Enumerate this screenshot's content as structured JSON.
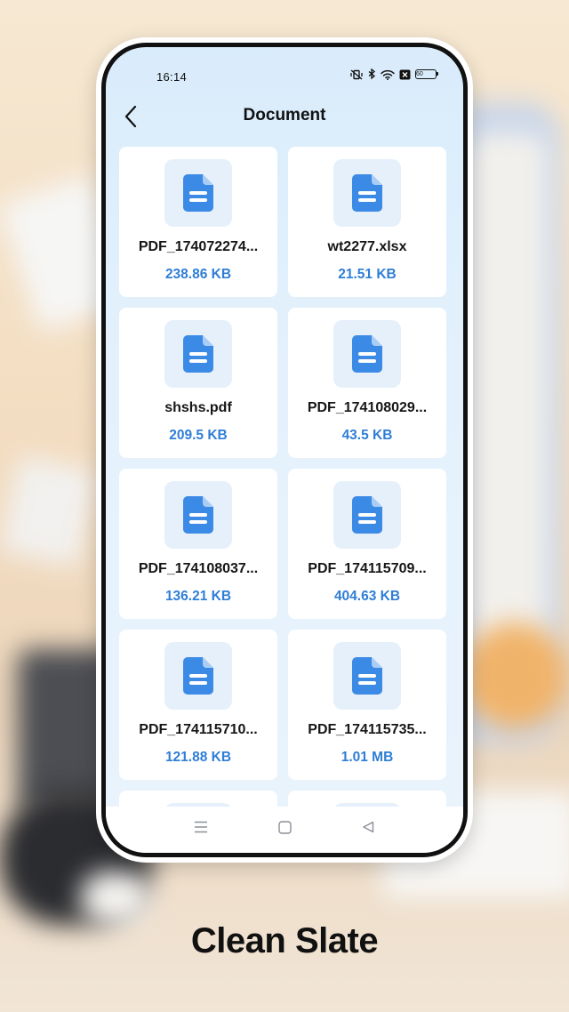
{
  "status_bar": {
    "time": "16:14",
    "battery": "60",
    "icons": [
      "mute-vibrate-icon",
      "bluetooth-icon",
      "wifi-icon",
      "sim-off-icon",
      "battery-icon"
    ]
  },
  "header": {
    "title": "Document",
    "back_icon": "chevron-left-icon"
  },
  "files": [
    {
      "name": "PDF_174072274...",
      "size": "238.86 KB"
    },
    {
      "name": "wt2277.xlsx",
      "size": "21.51 KB"
    },
    {
      "name": "shshs.pdf",
      "size": "209.5 KB"
    },
    {
      "name": "PDF_174108029...",
      "size": "43.5 KB"
    },
    {
      "name": "PDF_174108037...",
      "size": "136.21 KB"
    },
    {
      "name": "PDF_174115709...",
      "size": "404.63 KB"
    },
    {
      "name": "PDF_174115710...",
      "size": "121.88 KB"
    },
    {
      "name": "PDF_174115735...",
      "size": "1.01 MB"
    }
  ],
  "nav": {
    "icons": [
      "menu-icon",
      "home-square-icon",
      "back-triangle-icon"
    ]
  },
  "colors": {
    "accent": "#2f7ed6",
    "doc_icon": "#3b8ae6",
    "doc_icon_bg": "#e6f0fb"
  },
  "caption": "Clean Slate"
}
